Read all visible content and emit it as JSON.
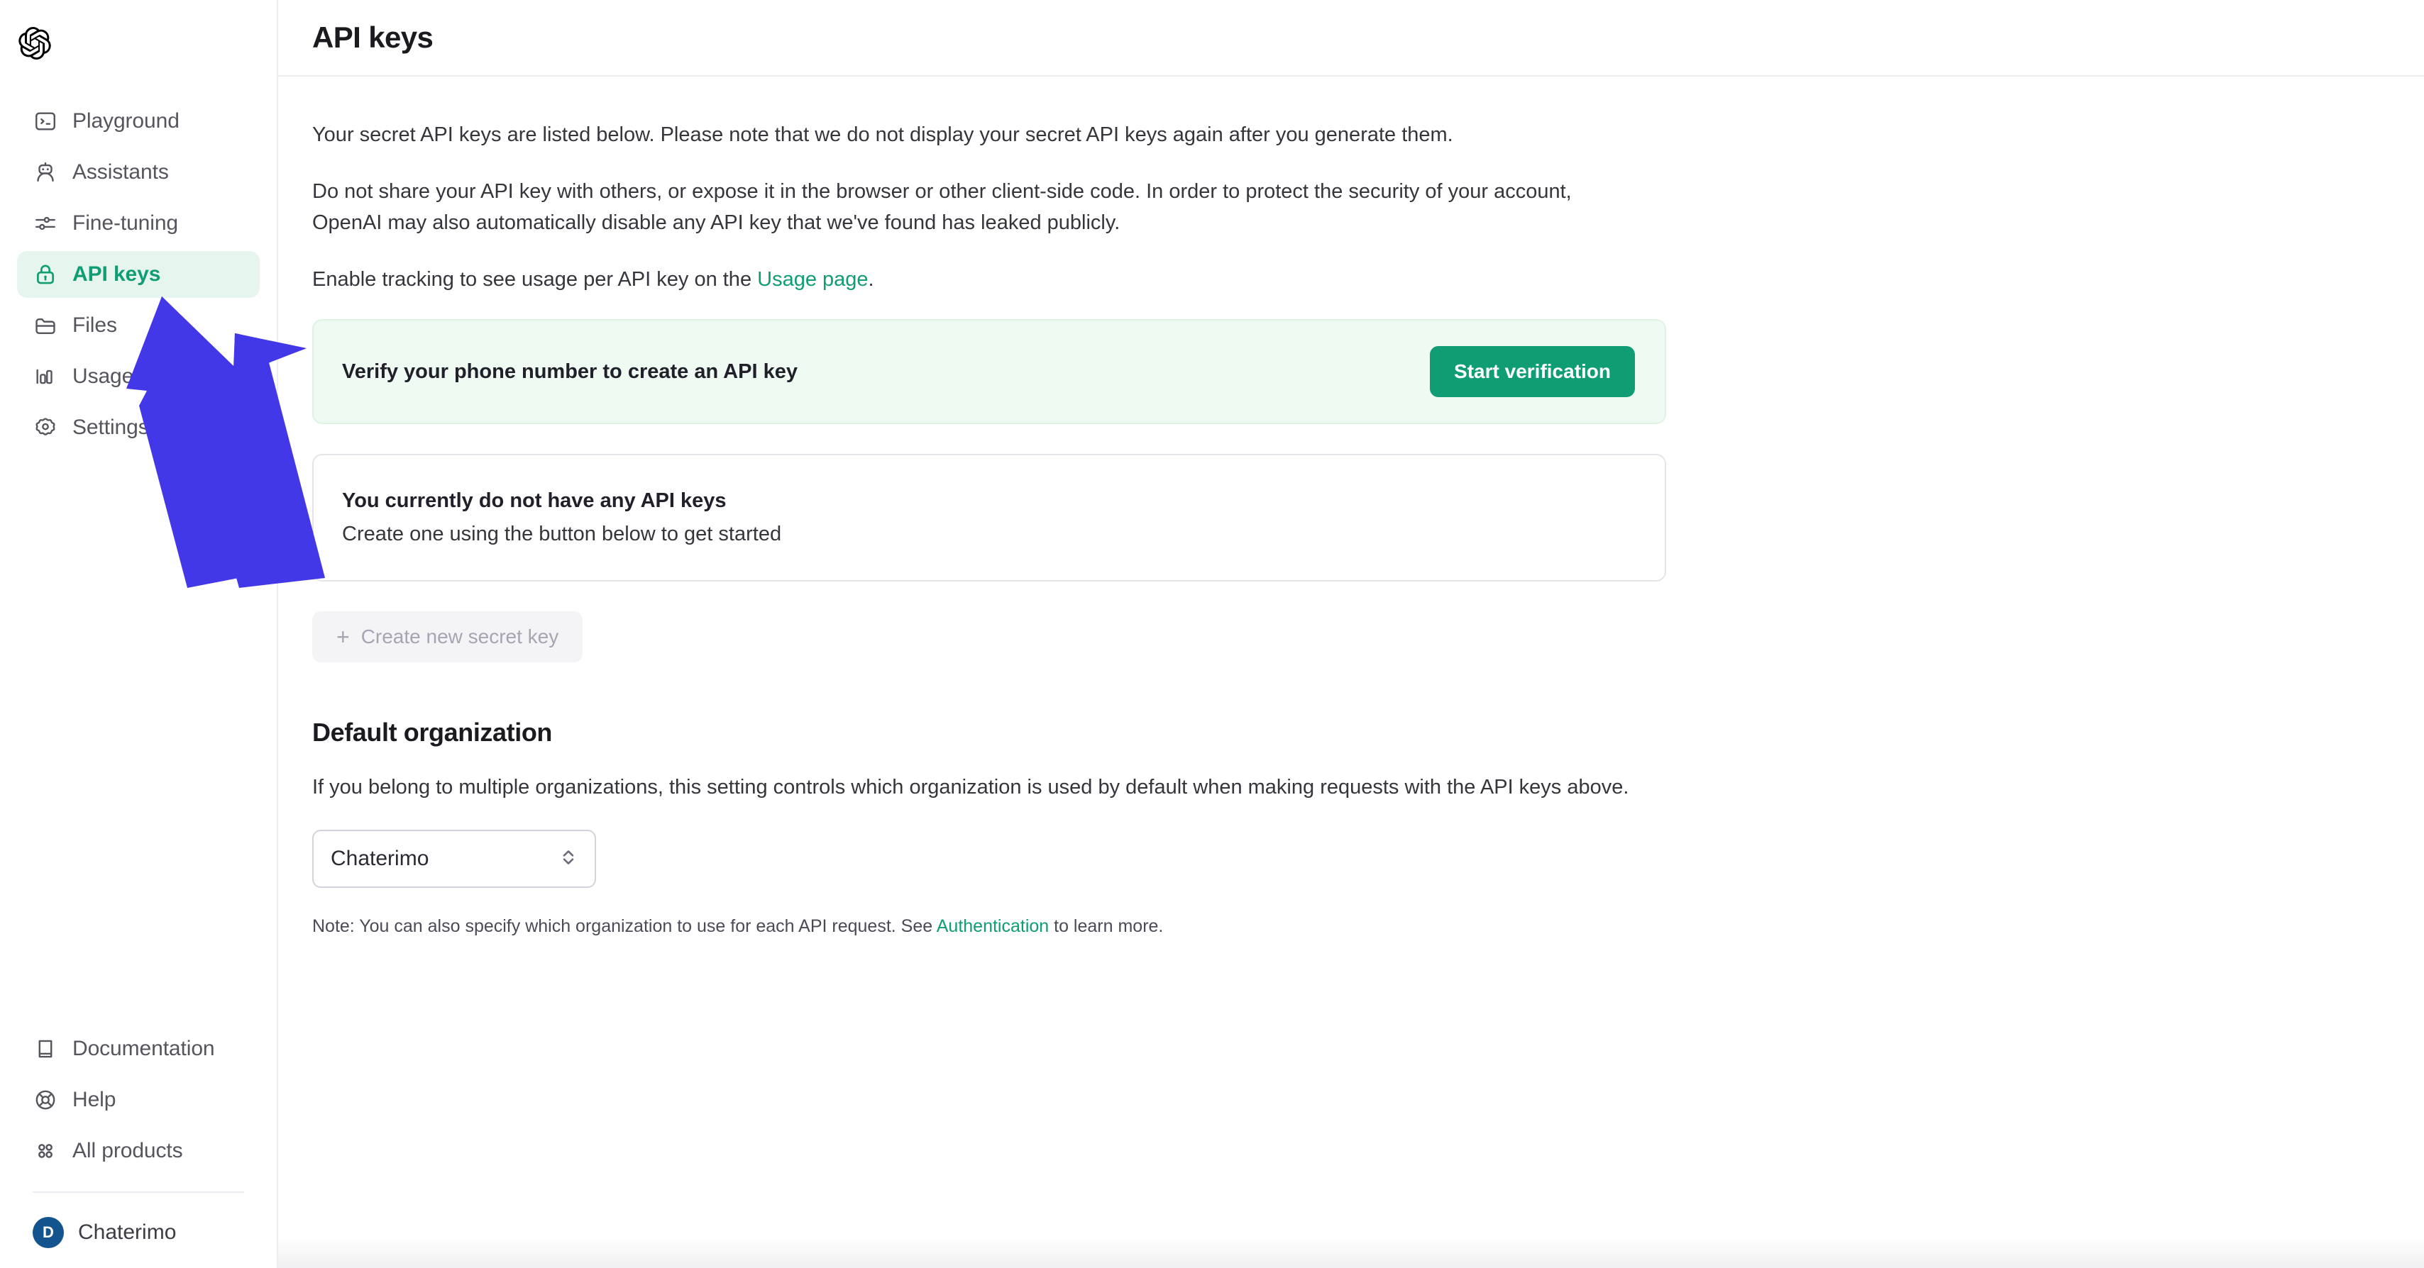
{
  "brand": {
    "logo_icon": "openai-logo-icon"
  },
  "sidebar": {
    "top_items": [
      {
        "label": "Playground",
        "icon": "terminal-icon",
        "active": false
      },
      {
        "label": "Assistants",
        "icon": "robot-icon",
        "active": false
      },
      {
        "label": "Fine-tuning",
        "icon": "sliders-icon",
        "active": false
      },
      {
        "label": "API keys",
        "icon": "lock-icon",
        "active": true
      },
      {
        "label": "Files",
        "icon": "folder-icon",
        "active": false
      },
      {
        "label": "Usage",
        "icon": "bar-chart-icon",
        "active": false
      },
      {
        "label": "Settings",
        "icon": "gear-icon",
        "active": false
      }
    ],
    "bottom_items": [
      {
        "label": "Documentation",
        "icon": "book-icon"
      },
      {
        "label": "Help",
        "icon": "lifebuoy-icon"
      },
      {
        "label": "All products",
        "icon": "grid-dots-icon"
      }
    ],
    "account": {
      "initial": "D",
      "name": "Chaterimo"
    }
  },
  "header": {
    "title": "API keys"
  },
  "main": {
    "intro_paragraph": "Your secret API keys are listed below. Please note that we do not display your secret API keys again after you generate them.",
    "warning_paragraph": "Do not share your API key with others, or expose it in the browser or other client-side code. In order to protect the security of your account, OpenAI may also automatically disable any API key that we've found has leaked publicly.",
    "tracking_prefix": "Enable tracking to see usage per API key on the ",
    "tracking_link": "Usage page",
    "tracking_suffix": ".",
    "verify_banner": {
      "message": "Verify your phone number to create an API key",
      "button_label": "Start verification"
    },
    "empty_state": {
      "title": "You currently do not have any API keys",
      "subtitle": "Create one using the button below to get started"
    },
    "create_key_button": {
      "label": "Create new secret key",
      "plus_icon": "plus-icon",
      "disabled": true
    },
    "default_organization": {
      "title": "Default organization",
      "description": "If you belong to multiple organizations, this setting controls which organization is used by default when making requests with the API keys above.",
      "select_value": "Chaterimo",
      "select_chevron_icon": "chevron-updown-icon",
      "note_prefix": "Note: You can also specify which organization to use for each API request. See ",
      "note_link": "Authentication",
      "note_suffix": " to learn more."
    }
  },
  "annotation": {
    "arrow_icon": "up-arrow-annotation-icon",
    "color": "#4338e8"
  },
  "colors": {
    "accent_green": "#0f9d74",
    "active_nav_bg": "#e7f5ef",
    "banner_bg": "#effaf2",
    "avatar_blue": "#13548f"
  }
}
